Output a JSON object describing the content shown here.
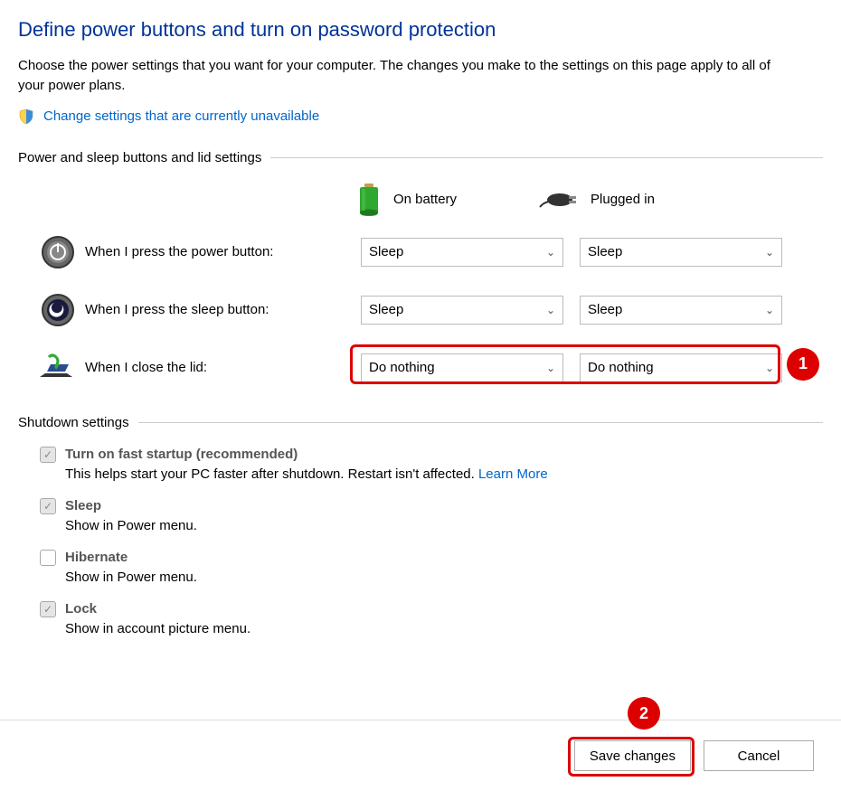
{
  "page": {
    "title": "Define power buttons and turn on password protection",
    "description": "Choose the power settings that you want for your computer. The changes you make to the settings on this page apply to all of your power plans.",
    "change_link": "Change settings that are currently unavailable"
  },
  "sections": {
    "power_buttons": {
      "label": "Power and sleep buttons and lid settings",
      "columns": {
        "battery": "On battery",
        "plugged": "Plugged in"
      },
      "rows": [
        {
          "label": "When I press the power button:",
          "battery_value": "Sleep",
          "plugged_value": "Sleep"
        },
        {
          "label": "When I press the sleep button:",
          "battery_value": "Sleep",
          "plugged_value": "Sleep"
        },
        {
          "label": "When I close the lid:",
          "battery_value": "Do nothing",
          "plugged_value": "Do nothing"
        }
      ]
    },
    "shutdown": {
      "label": "Shutdown settings",
      "items": [
        {
          "title": "Turn on fast startup (recommended)",
          "desc_pre": "This helps start your PC faster after shutdown. Restart isn't affected. ",
          "learn_more": "Learn More",
          "checked": true
        },
        {
          "title": "Sleep",
          "desc": "Show in Power menu.",
          "checked": true
        },
        {
          "title": "Hibernate",
          "desc": "Show in Power menu.",
          "checked": false
        },
        {
          "title": "Lock",
          "desc": "Show in account picture menu.",
          "checked": true
        }
      ]
    }
  },
  "footer": {
    "save": "Save changes",
    "cancel": "Cancel"
  },
  "annotations": {
    "callout_1": "1",
    "callout_2": "2"
  }
}
